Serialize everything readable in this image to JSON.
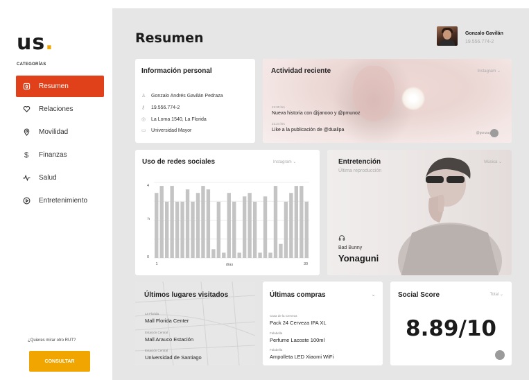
{
  "app": {
    "logo": "us",
    "logo_dot": "."
  },
  "sidebar": {
    "section_label": "CATEGORÍAS",
    "items": [
      {
        "label": "Resumen",
        "icon": "home-icon",
        "active": true
      },
      {
        "label": "Relaciones",
        "icon": "heart-icon",
        "active": false
      },
      {
        "label": "Movilidad",
        "icon": "location-pin-icon",
        "active": false
      },
      {
        "label": "Finanzas",
        "icon": "dollar-icon",
        "active": false
      },
      {
        "label": "Salud",
        "icon": "pulse-icon",
        "active": false
      },
      {
        "label": "Entretenimiento",
        "icon": "play-icon",
        "active": false
      }
    ],
    "rut_question": "¿Quieres mirar otro RUT?",
    "consult_label": "CONSULTAR"
  },
  "header": {
    "title": "Resumen",
    "user_name": "Gonzalo Gavilán",
    "user_rut": "19.556.774-2"
  },
  "personal": {
    "title": "Información personal",
    "rows": [
      {
        "icon": "user-icon",
        "text": "Gonzalo Andrés Gavilán Pedraza"
      },
      {
        "icon": "key-icon",
        "text": "19.556.774-2"
      },
      {
        "icon": "location-pin-icon",
        "text": "La Loma 1540, La Florida"
      },
      {
        "icon": "briefcase-icon",
        "text": "Universidad Mayor"
      }
    ]
  },
  "activity": {
    "title": "Actividad reciente",
    "dropdown": "Instagram",
    "items": [
      {
        "time": "21:30 hrs",
        "text": "Nueva historia con @janooo y @pmunoz"
      },
      {
        "time": "21:24 hrs",
        "text": "Like a la publicación de @dualipa"
      }
    ],
    "handle": "@gonzag"
  },
  "social": {
    "title": "Uso de redes sociales",
    "dropdown": "Instagram"
  },
  "chart_data": {
    "type": "bar",
    "xlabel": "días",
    "ylabel": "h",
    "x_ticks": [
      "1",
      "30"
    ],
    "y_ticks": [
      "0",
      "4"
    ],
    "ylim": [
      0,
      4.3
    ],
    "values": [
      3.7,
      4.1,
      3.2,
      4.1,
      3.2,
      3.2,
      3.9,
      3.2,
      3.7,
      4.1,
      3.9,
      0.5,
      3.2,
      0.3,
      3.7,
      3.2,
      0.3,
      3.5,
      3.7,
      3.2,
      0.3,
      3.5,
      0.3,
      4.1,
      0.8,
      3.2,
      3.7,
      4.1,
      4.1,
      3.2
    ]
  },
  "entertainment": {
    "title": "Entretención",
    "subtitle": "Última reproducción",
    "dropdown": "Música",
    "artist": "Bad Bunny",
    "song": "Yonaguni"
  },
  "places": {
    "title": "Últimos lugares visitados",
    "items": [
      {
        "city": "La Florida",
        "name": "Mall Florida Center"
      },
      {
        "city": "Estación Central",
        "name": "Mall Arauco Estación"
      },
      {
        "city": "Estación Central",
        "name": "Universidad de Santiago"
      }
    ]
  },
  "purchases": {
    "title": "Últimas compras",
    "items": [
      {
        "store": "Casa de la Cerveza",
        "name": "Pack 24 Cerveza IPA XL"
      },
      {
        "store": "Falabella",
        "name": "Perfume Lacoste 100ml"
      },
      {
        "store": "Falabella",
        "name": "Ampolleta LED Xiaomi WiFi"
      }
    ]
  },
  "score": {
    "title": "Social Score",
    "dropdown": "Total",
    "value": "8.89/10"
  },
  "colors": {
    "accent": "#e0411b",
    "button": "#f0a500",
    "background": "#e6e6e6"
  }
}
